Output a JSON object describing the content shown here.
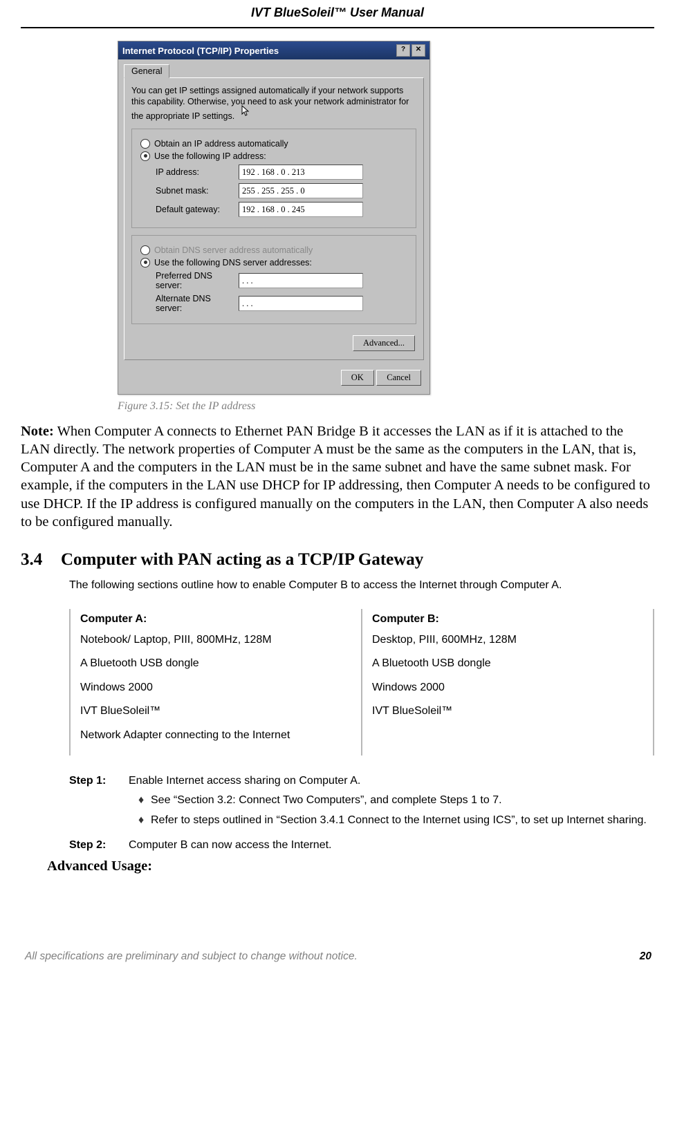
{
  "header": {
    "title": "IVT BlueSoleil™ User Manual"
  },
  "dialog": {
    "title": "Internet Protocol (TCP/IP) Properties",
    "tab": "General",
    "desc": "You can get IP settings assigned automatically if your network supports this capability. Otherwise, you need to ask your network administrator for the appropriate IP settings.",
    "opt_auto": "Obtain an IP address automatically",
    "opt_manual": "Use the following IP address:",
    "lbl_ip": "IP address:",
    "val_ip": "192 . 168 .   0  . 213",
    "lbl_mask": "Subnet mask:",
    "val_mask": "255 . 255 . 255 .   0",
    "lbl_gw": "Default gateway:",
    "val_gw": "192 . 168 .   0  . 245",
    "opt_dns_auto": "Obtain DNS server address automatically",
    "opt_dns_manual": "Use the following DNS server addresses:",
    "lbl_pref_dns": "Preferred DNS server:",
    "val_pref_dns": " .       .       . ",
    "lbl_alt_dns": "Alternate DNS server:",
    "val_alt_dns": " .       .       . ",
    "btn_adv": "Advanced...",
    "btn_ok": "OK",
    "btn_cancel": "Cancel"
  },
  "figure_caption": "Figure 3.15: Set the IP address",
  "note": {
    "label": "Note:",
    "text": " When Computer A connects to Ethernet PAN Bridge B it accesses the LAN as if it is attached to the LAN directly. The network properties of Computer A must be the same as the computers in the LAN, that is, Computer A and the computers in the LAN must be in the same subnet and have the same subnet mask. For example, if the computers in the LAN use DHCP for IP addressing, then Computer A needs to be configured to use DHCP. If the IP address is configured manually on the computers in the LAN, then Computer A also needs to be configured manually."
  },
  "section": {
    "num": "3.4",
    "title": "Computer with PAN acting as a TCP/IP Gateway",
    "intro": "The following sections outline how to enable Computer B to access the Internet through Computer A."
  },
  "specs": {
    "a": {
      "head": "Computer A:",
      "r1": "Notebook/ Laptop, PIII, 800MHz, 128M",
      "r2": "A Bluetooth USB dongle",
      "r3": "Windows 2000",
      "r4": "IVT BlueSoleil™",
      "r5": "Network Adapter connecting to the Internet"
    },
    "b": {
      "head": "Computer B:",
      "r1": "Desktop, PIII, 600MHz, 128M",
      "r2": "A Bluetooth USB dongle",
      "r3": "Windows 2000",
      "r4": "IVT BlueSoleil™"
    }
  },
  "steps": {
    "s1_label": "Step 1:",
    "s1_text": "Enable Internet access sharing on Computer A.",
    "s1_b1": "See “Section 3.2: Connect Two Computers”, and complete Steps 1 to 7.",
    "s1_b2": "Refer to steps outlined in “Section 3.4.1 Connect to the Internet using ICS”, to set up Internet sharing.",
    "s2_label": "Step 2:",
    "s2_text": "Computer B can now access the Internet."
  },
  "advanced_usage": "Advanced Usage:",
  "footer": {
    "text": "All specifications are preliminary and subject to change without notice.",
    "page": "20"
  }
}
